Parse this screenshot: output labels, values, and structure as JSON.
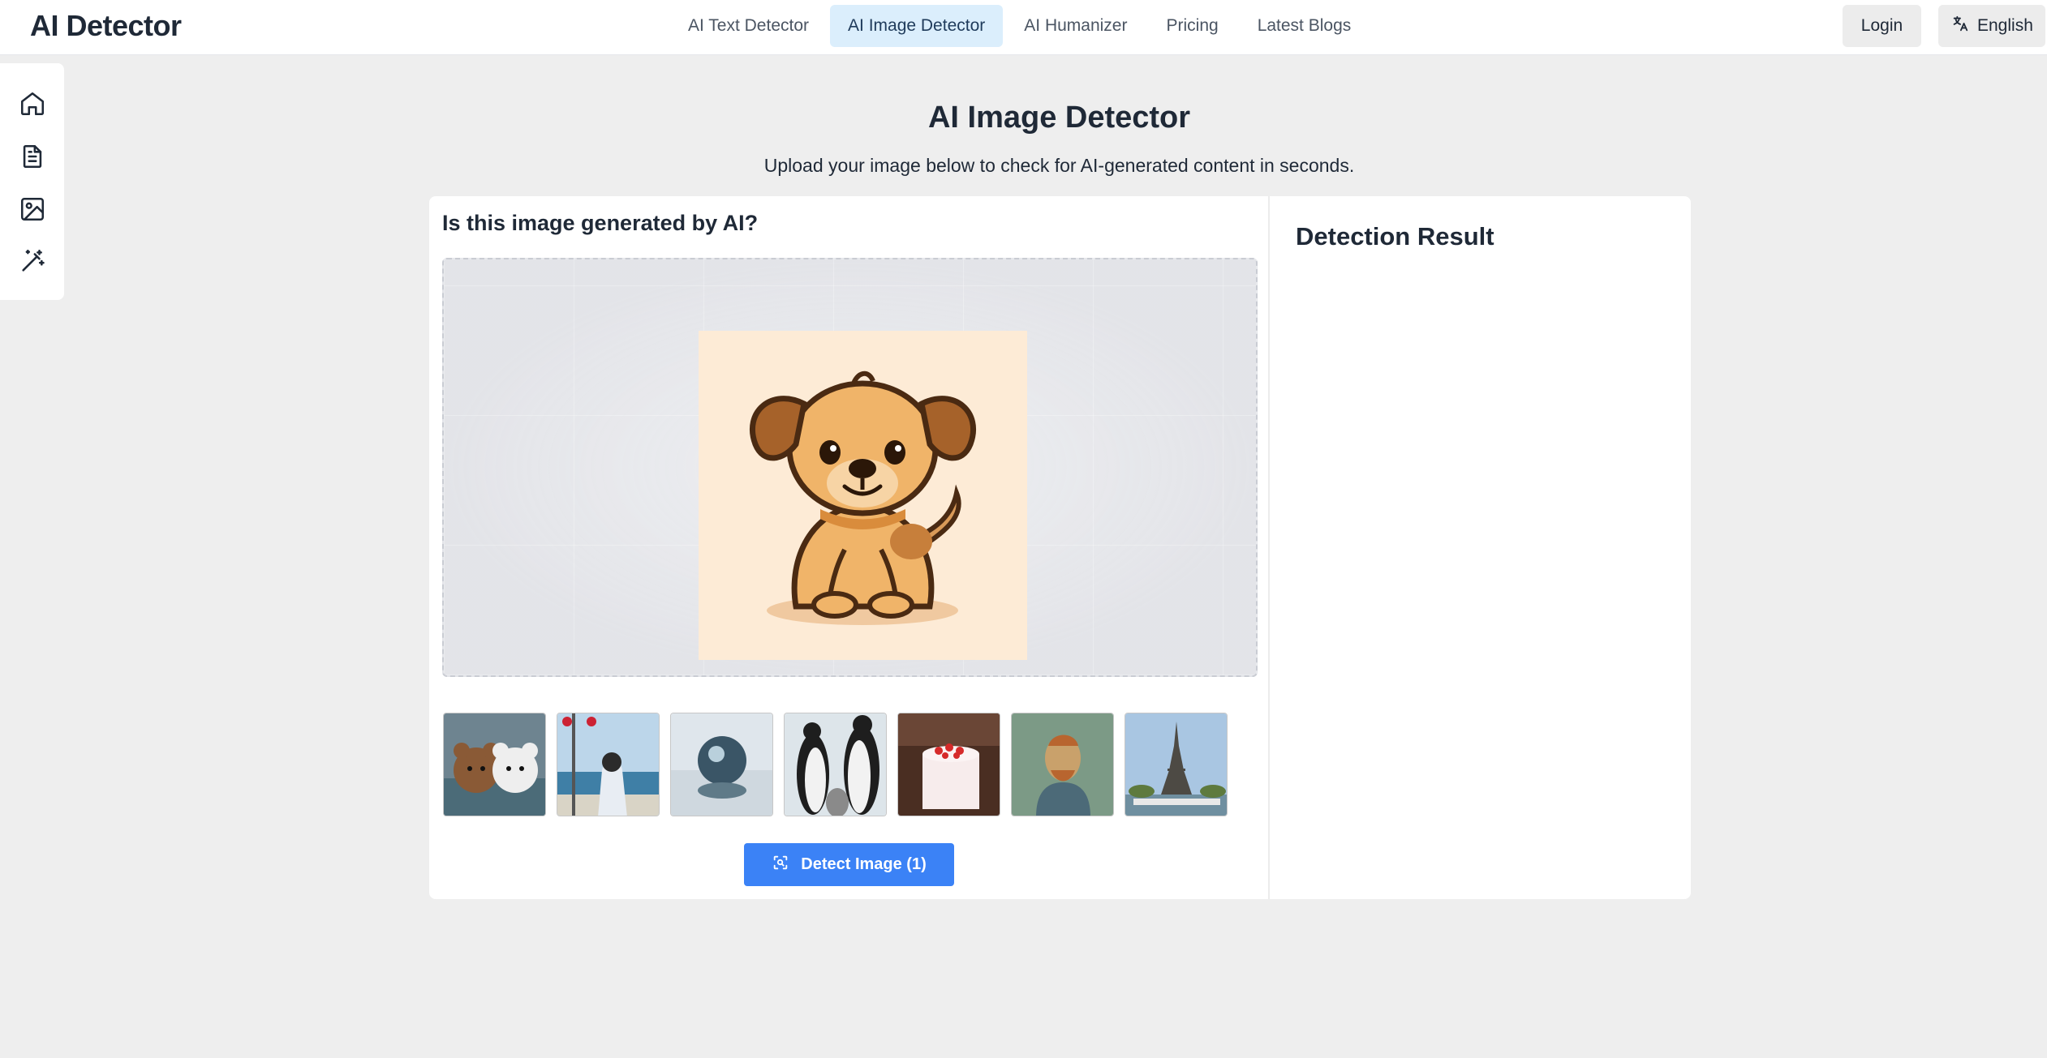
{
  "brand": "AI Detector",
  "nav": {
    "items": [
      {
        "label": "AI Text Detector"
      },
      {
        "label": "AI Image Detector",
        "active": true
      },
      {
        "label": "AI Humanizer"
      },
      {
        "label": "Pricing"
      },
      {
        "label": "Latest Blogs"
      }
    ],
    "login_label": "Login",
    "language_label": "English"
  },
  "sidebar": {
    "items": [
      {
        "icon": "home-icon"
      },
      {
        "icon": "document-icon"
      },
      {
        "icon": "image-icon"
      },
      {
        "icon": "magic-wand-icon"
      }
    ]
  },
  "page": {
    "title": "AI Image Detector",
    "subtitle": "Upload your image below to check for AI-generated content in seconds."
  },
  "upload": {
    "heading": "Is this image generated by AI?",
    "preview_image": "cartoon-puppy",
    "samples": [
      {
        "name": "teddy-bears-in-water"
      },
      {
        "name": "girl-at-railway-crossing"
      },
      {
        "name": "crystal-sphere-reflection"
      },
      {
        "name": "penguins"
      },
      {
        "name": "strawberry-cake"
      },
      {
        "name": "van-gogh-portrait"
      },
      {
        "name": "eiffel-tower"
      }
    ],
    "detect_button": "Detect Image (1)"
  },
  "result": {
    "title": "Detection Result"
  },
  "colors": {
    "accent": "#3b82f6",
    "nav_active_bg": "#dbeefc",
    "page_bg": "#eeeeee"
  }
}
